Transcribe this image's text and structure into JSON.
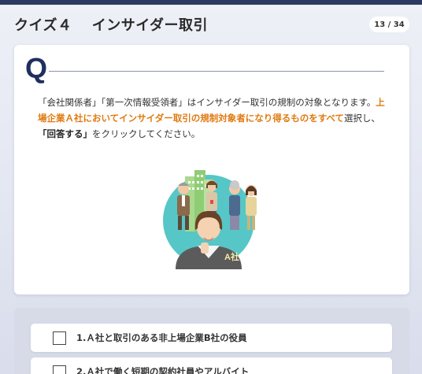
{
  "header": {
    "title": "クイズ４　 インサイダー取引",
    "page_counter": "13 / 34"
  },
  "question": {
    "mark": "Q",
    "text_parts": {
      "p1": "「会社関係者」「第一次情報受領者」はインサイダー取引の規制の対象となります。",
      "p2_highlight": "上場企業Ａ社においてインサイダー取引の規制対象者になり得るものをすべて",
      "p3": "選択し、",
      "p4_bold": "「回答する」",
      "p5": "をクリックしてください。"
    },
    "illustration": {
      "icon": "people-office-illustration",
      "label": "A社"
    }
  },
  "options": [
    {
      "label": "1.Ａ社と取引のある非上場企業B社の役員",
      "checked": false
    },
    {
      "label": "2.Ａ社で働く短期の契約社員やアルバイト",
      "checked": false
    }
  ],
  "colors": {
    "accent": "#e07a12",
    "navy": "#1f2f5e",
    "topbar": "#2c3a63"
  }
}
